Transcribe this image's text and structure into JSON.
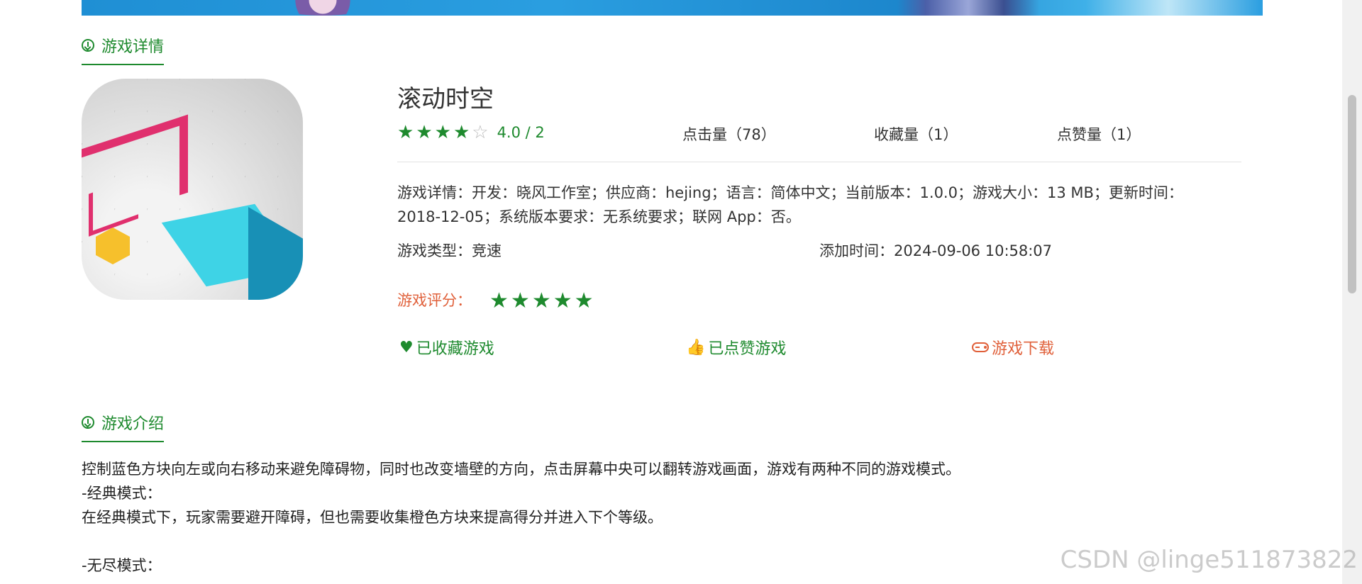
{
  "sections": {
    "details_title": "游戏详情",
    "intro_title": "游戏介绍"
  },
  "game": {
    "title": "滚动时空",
    "rating_text": "4.0 / 2",
    "rating_stars": 4,
    "rating_stars_max": 5,
    "stats": {
      "clicks": "点击量（78）",
      "favorites": "收藏量（1）",
      "likes": "点赞量（1）"
    },
    "details_line": "游戏详情：开发：晓风工作室；供应商：hejing；语言：简体中文；当前版本：1.0.0；游戏大小：13 MB；更新时间：2018-12-05；系统版本要求：无系统要求；联网 App：否。",
    "type": "游戏类型：竞速",
    "added_time": "添加时间：2024-09-06 10:58:07",
    "score_label": "游戏评分：",
    "score_stars": 5
  },
  "actions": {
    "favorite": "已收藏游戏",
    "like": "已点赞游戏",
    "download": "游戏下载"
  },
  "intro": {
    "lines": [
      "控制蓝色方块向左或向右移动来避免障碍物，同时也改变墙壁的方向，点击屏幕中央可以翻转游戏画面，游戏有两种不同的游戏模式。",
      "-经典模式：",
      "在经典模式下，玩家需要避开障碍，但也需要收集橙色方块来提高得分并进入下个等级。",
      "",
      "-无尽模式："
    ]
  },
  "watermark": "CSDN @linge511873822",
  "colors": {
    "accent_green": "#1e8a2e",
    "accent_orange": "#e0603a"
  }
}
